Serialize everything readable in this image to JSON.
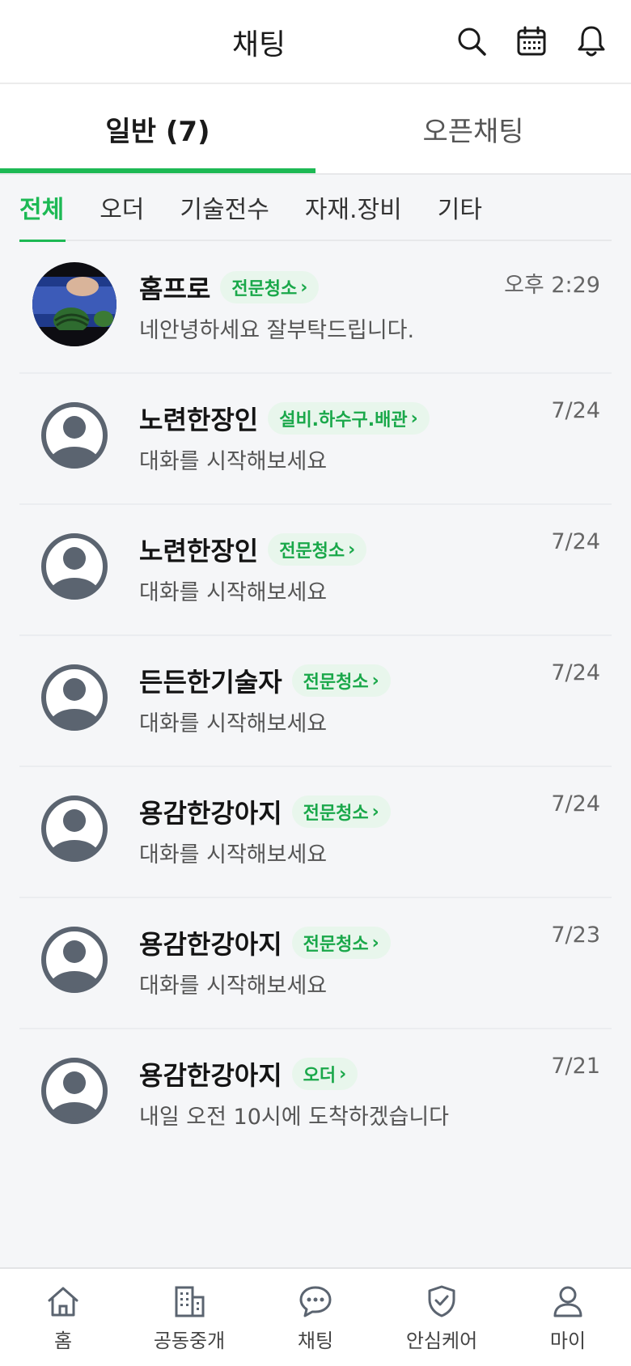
{
  "header": {
    "title": "채팅",
    "icons": [
      "search-icon",
      "calendar-icon",
      "bell-icon"
    ]
  },
  "main_tabs": [
    {
      "label": "일반 (7)",
      "active": true
    },
    {
      "label": "오픈채팅",
      "active": false
    }
  ],
  "sub_tabs": [
    {
      "label": "전체",
      "active": true
    },
    {
      "label": "오더",
      "active": false
    },
    {
      "label": "기술전수",
      "active": false
    },
    {
      "label": "자재.장비",
      "active": false
    },
    {
      "label": "기타",
      "active": false
    }
  ],
  "chats": [
    {
      "name": "홈프로",
      "badge": "전문청소",
      "message": "네안녕하세요 잘부탁드립니다.",
      "time": "오후 2:29",
      "avatar": "photo"
    },
    {
      "name": "노련한장인",
      "badge": "설비.하수구.배관",
      "message": "대화를 시작해보세요",
      "time": "7/24",
      "avatar": "default"
    },
    {
      "name": "노련한장인",
      "badge": "전문청소",
      "message": "대화를 시작해보세요",
      "time": "7/24",
      "avatar": "default"
    },
    {
      "name": "든든한기술자",
      "badge": "전문청소",
      "message": "대화를 시작해보세요",
      "time": "7/24",
      "avatar": "default"
    },
    {
      "name": "용감한강아지",
      "badge": "전문청소",
      "message": "대화를 시작해보세요",
      "time": "7/24",
      "avatar": "default"
    },
    {
      "name": "용감한강아지",
      "badge": "전문청소",
      "message": "대화를 시작해보세요",
      "time": "7/23",
      "avatar": "default"
    },
    {
      "name": "용감한강아지",
      "badge": "오더",
      "message": "내일 오전 10시에 도착하겠습니다",
      "time": "7/21",
      "avatar": "default"
    }
  ],
  "bottom_nav": [
    {
      "label": "홈",
      "icon": "home-icon"
    },
    {
      "label": "공동중개",
      "icon": "building-icon"
    },
    {
      "label": "채팅",
      "icon": "chat-bubble-icon"
    },
    {
      "label": "안심케어",
      "icon": "shield-check-icon"
    },
    {
      "label": "마이",
      "icon": "person-icon"
    }
  ],
  "colors": {
    "accent": "#1db954",
    "badge_bg": "#e8f6ec",
    "badge_text": "#1aa84a",
    "avatar_gray": "#5b6470",
    "background": "#f5f6f8"
  }
}
